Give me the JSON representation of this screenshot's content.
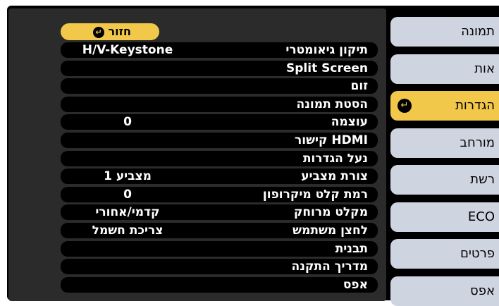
{
  "tabs": [
    {
      "label": "תמונה",
      "selected": false
    },
    {
      "label": "אות",
      "selected": false
    },
    {
      "label": "הגדרות",
      "selected": true
    },
    {
      "label": "מורחב",
      "selected": false
    },
    {
      "label": "רשת",
      "selected": false
    },
    {
      "label": "ECO",
      "selected": false
    },
    {
      "label": "פרטים",
      "selected": false
    },
    {
      "label": "אפס",
      "selected": false
    }
  ],
  "return_button": {
    "label": "חזור"
  },
  "rows": [
    {
      "label": "תיקון גיאומטרי",
      "value": "H/V-Keystone"
    },
    {
      "label": "Split Screen",
      "value": ""
    },
    {
      "label": "זום",
      "value": ""
    },
    {
      "label": "הסטת תמונה",
      "value": ""
    },
    {
      "label": "עוצמה",
      "value": "0"
    },
    {
      "label": "קישור HDMI",
      "value": ""
    },
    {
      "label": "נעל הגדרות",
      "value": ""
    },
    {
      "label": "צורת מצביע",
      "value": "מצביע 1"
    },
    {
      "label": "רמת קלט מיקרופון",
      "value": "0"
    },
    {
      "label": "מקלט מרוחק",
      "value": "קדמי/אחורי"
    },
    {
      "label": "לחצן משתמש",
      "value": "צריכת חשמל"
    },
    {
      "label": "תבנית",
      "value": ""
    },
    {
      "label": "מדריך התקנה",
      "value": ""
    },
    {
      "label": "אפס",
      "value": ""
    }
  ],
  "colors": {
    "selected": "#f2c84a",
    "tab": "#cfd4e1",
    "panel": "#2b2b2b"
  }
}
